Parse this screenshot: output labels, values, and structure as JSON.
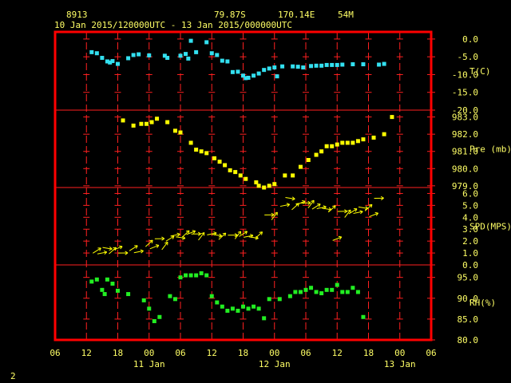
{
  "header": {
    "station_id": "8913",
    "latitude": "79.87S",
    "longitude": "170.14E",
    "elevation": "54M",
    "time_range": "10 Jan 2015/120000UTC - 13 Jan 2015/000000UTC"
  },
  "footer": {
    "page_number": "2"
  },
  "colors": {
    "background": "#000000",
    "frame": "#ff0000",
    "grid": "#ff2020",
    "text": "#ffff66",
    "temperature": "#33e0f0",
    "pressure": "#ffff00",
    "wind": "#ffff00",
    "humidity": "#22ee22"
  },
  "chart_data": {
    "type": "scatter",
    "x_unit": "hours since 10 Jan 2015 06 UTC",
    "x_range": [
      0,
      72
    ],
    "x_tick_labels": [
      "06",
      "12",
      "18",
      "00",
      "06",
      "12",
      "18",
      "00",
      "06",
      "12",
      "18",
      "00",
      "06"
    ],
    "date_labels": [
      {
        "label": "11 Jan",
        "x": 18
      },
      {
        "label": "12 Jan",
        "x": 42
      },
      {
        "label": "13 Jan",
        "x": 66
      }
    ],
    "panels": [
      {
        "name": "temperature",
        "ylabel": "T(C)",
        "ylim": [
          -20,
          2
        ],
        "ticks": [
          0,
          -5,
          -10,
          -15,
          -20
        ],
        "tick_labels": [
          "0.0",
          "-5.0",
          "-10.0",
          "-15.0",
          "-20.0"
        ],
        "marker": "square",
        "points": [
          [
            7,
            -3.7
          ],
          [
            8,
            -4
          ],
          [
            9,
            -5.3
          ],
          [
            10,
            -6.3
          ],
          [
            10.5,
            -6.6
          ],
          [
            11,
            -6.2
          ],
          [
            12,
            -7
          ],
          [
            14,
            -5.4
          ],
          [
            15,
            -4.5
          ],
          [
            16,
            -4.3
          ],
          [
            18,
            -4.6
          ],
          [
            21,
            -4.7
          ],
          [
            21.5,
            -5.3
          ],
          [
            24,
            -4.7
          ],
          [
            25,
            -4.2
          ],
          [
            25.5,
            -5.5
          ],
          [
            26,
            -0.5
          ],
          [
            27,
            -3.7
          ],
          [
            29,
            -0.9
          ],
          [
            30,
            -4
          ],
          [
            31,
            -4.5
          ],
          [
            32,
            -6.1
          ],
          [
            33,
            -6.3
          ],
          [
            34,
            -9.3
          ],
          [
            35,
            -9.2
          ],
          [
            36,
            -10.3
          ],
          [
            36.5,
            -11
          ],
          [
            37,
            -10.9
          ],
          [
            38,
            -10.3
          ],
          [
            39,
            -9.7
          ],
          [
            40,
            -8.7
          ],
          [
            41,
            -8.3
          ],
          [
            42,
            -8
          ],
          [
            42.5,
            -10.5
          ],
          [
            43.5,
            -7.7
          ],
          [
            45.5,
            -7.7
          ],
          [
            46.5,
            -7.8
          ],
          [
            47.5,
            -8
          ],
          [
            49,
            -7.6
          ],
          [
            50,
            -7.5
          ],
          [
            51,
            -7.5
          ],
          [
            52,
            -7.3
          ],
          [
            53,
            -7.3
          ],
          [
            54,
            -7.3
          ],
          [
            55,
            -7.2
          ],
          [
            57,
            -7.1
          ],
          [
            59,
            -7.1
          ],
          [
            62,
            -7.2
          ],
          [
            63,
            -7
          ]
        ]
      },
      {
        "name": "pressure",
        "ylabel": "Pre (mb)",
        "ylim": [
          978.9,
          983.4
        ],
        "ticks": [
          983,
          982,
          981,
          980,
          979
        ],
        "tick_labels": [
          "983.0",
          "982.0",
          "981.0",
          "980.0",
          "979.0"
        ],
        "marker": "square",
        "points": [
          [
            13,
            982.8
          ],
          [
            15,
            982.5
          ],
          [
            16.5,
            982.6
          ],
          [
            17.5,
            982.6
          ],
          [
            18.5,
            982.7
          ],
          [
            19.5,
            982.9
          ],
          [
            21.5,
            982.7
          ],
          [
            23,
            982.2
          ],
          [
            24,
            982.1
          ],
          [
            26,
            981.5
          ],
          [
            27,
            981.1
          ],
          [
            28,
            981
          ],
          [
            29,
            980.9
          ],
          [
            30.5,
            980.6
          ],
          [
            31.5,
            980.4
          ],
          [
            32.5,
            980.2
          ],
          [
            33.5,
            979.9
          ],
          [
            34.5,
            979.8
          ],
          [
            35.5,
            979.6
          ],
          [
            36.5,
            979.4
          ],
          [
            38.5,
            979.2
          ],
          [
            39,
            979
          ],
          [
            40,
            978.9
          ],
          [
            41,
            979
          ],
          [
            42,
            979.1
          ],
          [
            44,
            979.6
          ],
          [
            45.5,
            979.6
          ],
          [
            47,
            980.1
          ],
          [
            48.5,
            980.5
          ],
          [
            50,
            980.8
          ],
          [
            51,
            981
          ],
          [
            52,
            981.3
          ],
          [
            53,
            981.3
          ],
          [
            54,
            981.4
          ],
          [
            55,
            981.5
          ],
          [
            56,
            981.5
          ],
          [
            57,
            981.5
          ],
          [
            58,
            981.6
          ],
          [
            59,
            981.7
          ],
          [
            61,
            981.8
          ],
          [
            63,
            982
          ],
          [
            64.5,
            983
          ]
        ]
      },
      {
        "name": "wind",
        "ylabel": "SPD(MPS)",
        "ylim": [
          0,
          6.5
        ],
        "ticks": [
          6,
          5,
          4,
          3,
          2,
          1,
          0
        ],
        "tick_labels": [
          "6.0",
          "5.0",
          "4.0",
          "3.0",
          "2.0",
          "1.0",
          "0.0"
        ],
        "marker": "arrow",
        "points": [
          [
            8,
            1.2
          ],
          [
            9,
            1
          ],
          [
            10,
            1.4
          ],
          [
            11,
            1.2
          ],
          [
            12,
            1.4
          ],
          [
            13,
            1
          ],
          [
            15,
            1.4
          ],
          [
            16,
            1.1
          ],
          [
            18,
            1.8
          ],
          [
            19,
            1.5
          ],
          [
            20,
            2.2
          ],
          [
            21,
            1.6
          ],
          [
            22,
            2.2
          ],
          [
            23,
            2.5
          ],
          [
            24,
            2.3
          ],
          [
            25,
            2.6
          ],
          [
            26,
            2.7
          ],
          [
            27,
            2.6
          ],
          [
            28,
            2.4
          ],
          [
            30,
            2.6
          ],
          [
            31,
            2.5
          ],
          [
            32,
            2.4
          ],
          [
            34,
            2.5
          ],
          [
            35,
            2.5
          ],
          [
            36,
            2.6
          ],
          [
            37,
            2.4
          ],
          [
            38,
            2.3
          ],
          [
            39,
            2.5
          ],
          [
            41,
            4.2
          ],
          [
            42,
            4.1
          ],
          [
            44,
            5
          ],
          [
            45,
            5.6
          ],
          [
            46,
            4.9
          ],
          [
            47,
            5.2
          ],
          [
            48,
            5.2
          ],
          [
            49,
            5.1
          ],
          [
            50,
            4.9
          ],
          [
            51,
            4.8
          ],
          [
            52,
            4.7
          ],
          [
            53,
            4.7
          ],
          [
            54,
            2.2
          ],
          [
            55,
            4.5
          ],
          [
            56,
            4.3
          ],
          [
            57,
            4.5
          ],
          [
            58,
            4.4
          ],
          [
            59,
            4.8
          ],
          [
            60,
            4.8
          ],
          [
            61,
            4.2
          ],
          [
            62,
            5.6
          ]
        ]
      },
      {
        "name": "humidity",
        "ylabel": "RH(%)",
        "ylim": [
          80,
          98
        ],
        "ticks": [
          95,
          90,
          85,
          80
        ],
        "tick_labels": [
          "95.0",
          "90.0",
          "85.0",
          "80.0"
        ],
        "marker": "square",
        "points": [
          [
            7,
            94
          ],
          [
            8,
            94.5
          ],
          [
            9,
            92
          ],
          [
            9.5,
            91
          ],
          [
            10,
            94.5
          ],
          [
            11,
            93.5
          ],
          [
            12,
            91.8
          ],
          [
            14,
            91
          ],
          [
            17,
            89.5
          ],
          [
            18,
            87.5
          ],
          [
            19,
            84.5
          ],
          [
            20,
            85.5
          ],
          [
            22,
            90.5
          ],
          [
            23,
            89.8
          ],
          [
            24,
            95
          ],
          [
            25,
            95.5
          ],
          [
            26,
            95.5
          ],
          [
            27,
            95.5
          ],
          [
            28,
            96
          ],
          [
            29,
            95.5
          ],
          [
            30,
            90.5
          ],
          [
            31,
            89
          ],
          [
            32,
            88
          ],
          [
            33,
            87
          ],
          [
            34,
            87.5
          ],
          [
            35,
            87
          ],
          [
            36,
            88
          ],
          [
            37,
            87.5
          ],
          [
            38,
            88
          ],
          [
            39,
            87.5
          ],
          [
            40,
            85.2
          ],
          [
            41,
            89.8
          ],
          [
            43,
            89.8
          ],
          [
            45,
            90.5
          ],
          [
            46,
            91.5
          ],
          [
            47,
            91.5
          ],
          [
            48,
            92
          ],
          [
            49,
            92.5
          ],
          [
            50,
            91.5
          ],
          [
            51,
            91.2
          ],
          [
            52,
            92
          ],
          [
            53,
            92
          ],
          [
            54,
            93.2
          ],
          [
            55,
            91.5
          ],
          [
            56,
            91.5
          ],
          [
            57,
            92.5
          ],
          [
            58,
            91.5
          ],
          [
            59,
            85.5
          ]
        ]
      }
    ]
  }
}
